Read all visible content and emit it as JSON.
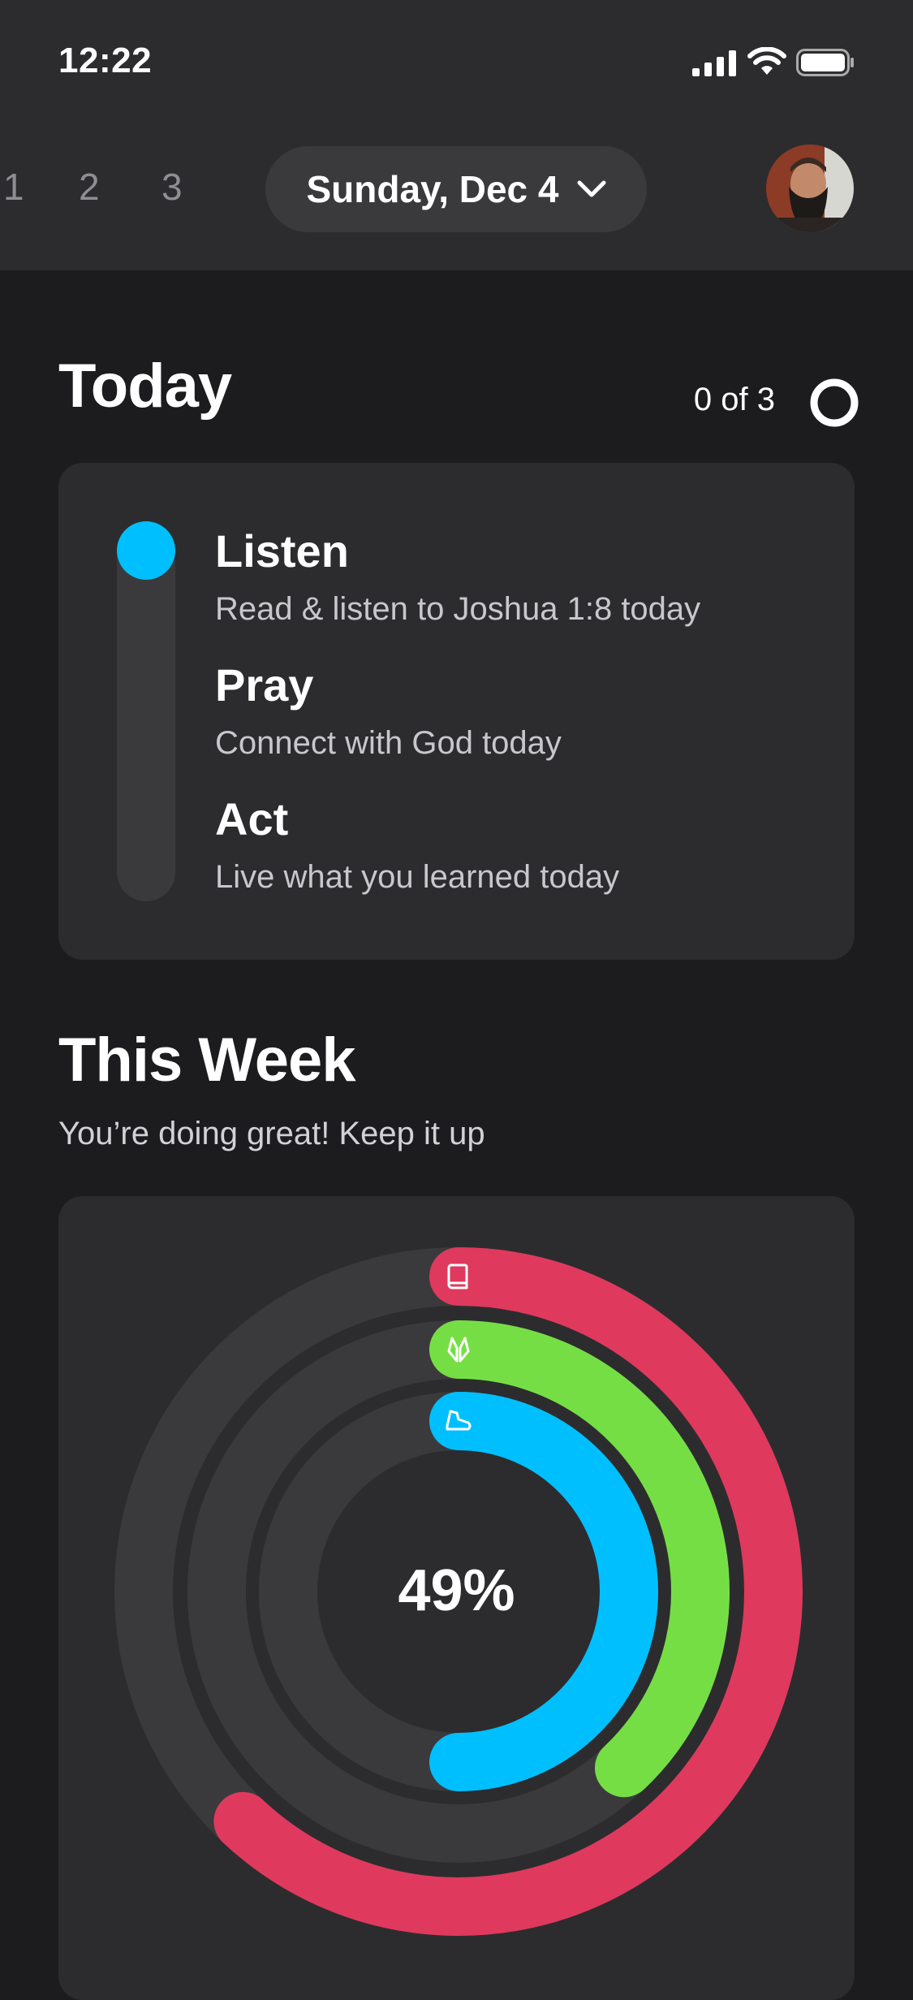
{
  "status": {
    "time": "12:22"
  },
  "week_nav": {
    "weeks": [
      "1",
      "2",
      "3"
    ],
    "date": "Sunday, Dec 4"
  },
  "today": {
    "title": "Today",
    "progress": "0 of 3",
    "steps": [
      {
        "title": "Listen",
        "desc": "Read & listen to Joshua 1:8 today"
      },
      {
        "title": "Pray",
        "desc": "Connect with God today"
      },
      {
        "title": "Act",
        "desc": "Live what you learned today"
      }
    ]
  },
  "this_week": {
    "title": "This Week",
    "subtitle": "You’re doing great! Keep it up",
    "percent": "49%",
    "rings": [
      {
        "name": "listen",
        "icon": "book-icon",
        "color": "#e0395e",
        "fraction": 0.62
      },
      {
        "name": "pray",
        "icon": "praying-hands-icon",
        "color": "#76de45",
        "fraction": 0.38
      },
      {
        "name": "act",
        "icon": "shoe-icon",
        "color": "#00bfff",
        "fraction": 0.5
      }
    ]
  },
  "colors": {
    "background": "#1c1c1e",
    "surface": "#2c2c2e",
    "accent": "#00bfff"
  }
}
